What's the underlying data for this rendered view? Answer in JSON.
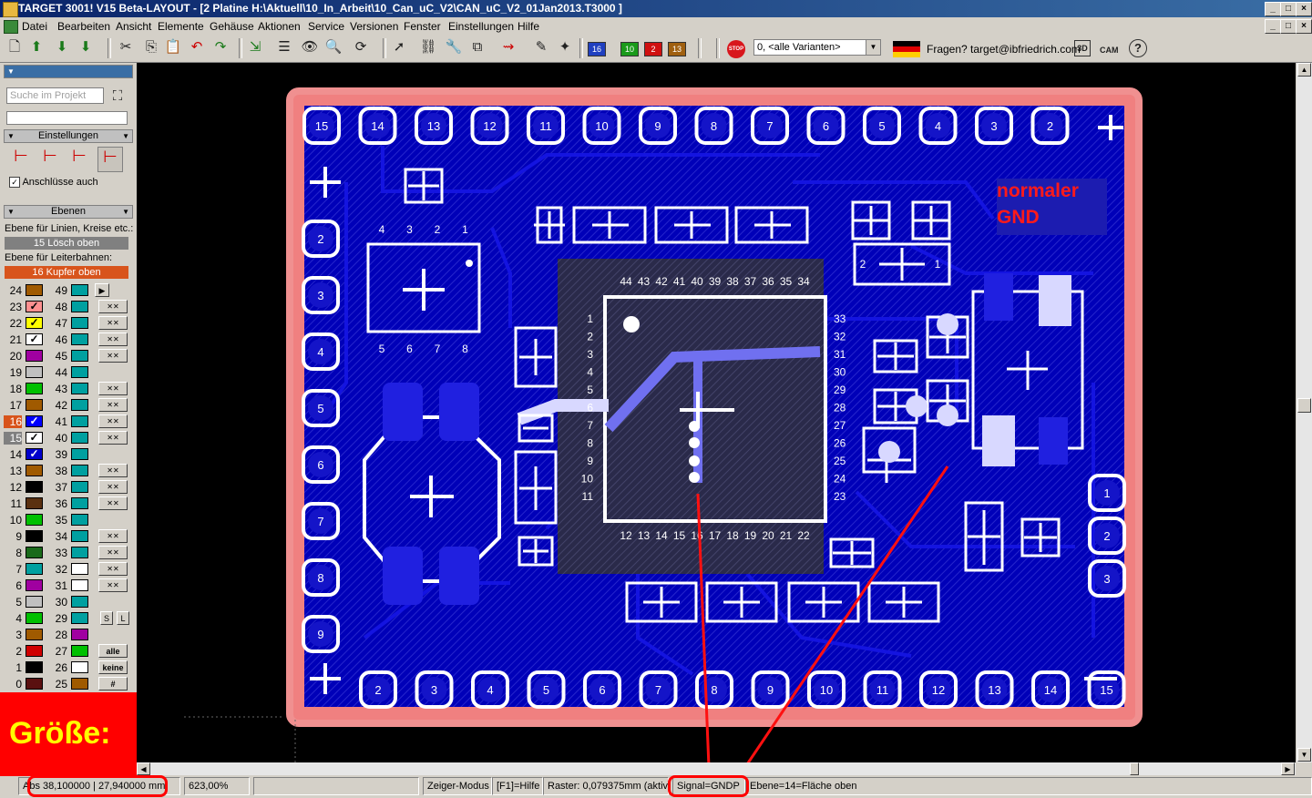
{
  "window": {
    "title": "TARGET 3001! V15 Beta-LAYOUT - [2 Platine H:\\Aktuell\\10_In_Arbeit\\10_Can_uC_V2\\CAN_uC_V2_01Jan2013.T3000 ]"
  },
  "menu": [
    "Datei",
    "Bearbeiten",
    "Ansicht",
    "Elemente",
    "Gehäuse",
    "Aktionen",
    "Service",
    "Versionen",
    "Fenster",
    "Einstellungen",
    "Hilfe"
  ],
  "toolbar": {
    "layer_badges": [
      "16",
      "10",
      "2",
      "13"
    ],
    "variant": "0, <alle Varianten>",
    "help": "Fragen? target@ibfriedrich.com",
    "stop_label": "STOP",
    "btn_3d": "3D",
    "btn_cam": "CAM",
    "btn_help": "?"
  },
  "left_panel": {
    "search_placeholder": "Suche im Projekt",
    "settings_header": "Einstellungen",
    "also_connections": "Anschlüsse auch",
    "layers_header": "Ebenen",
    "line_layer_label": "Ebene für Linien, Kreise etc.:",
    "line_layer_value": "15 Lösch oben",
    "track_layer_label": "Ebene für Leiterbahnen:",
    "track_layer_value": "16 Kupfer oben",
    "btn_s": "S",
    "btn_l": "L",
    "btn_all": "alle",
    "btn_none": "keine",
    "btn_hash": "#",
    "layers_left": [
      {
        "n": "24",
        "color": "#a05a00",
        "mark": ""
      },
      {
        "n": "23",
        "color": "#ff9090",
        "mark": "✓"
      },
      {
        "n": "22",
        "color": "#ffff00",
        "mark": "✓"
      },
      {
        "n": "21",
        "color": "#ffffff",
        "mark": "✓"
      },
      {
        "n": "20",
        "color": "#a000a0",
        "mark": ""
      },
      {
        "n": "19",
        "color": "#c0c0c0",
        "mark": ""
      },
      {
        "n": "18",
        "color": "#00c000",
        "mark": ""
      },
      {
        "n": "17",
        "color": "#a05a00",
        "mark": ""
      },
      {
        "n": "16",
        "color": "#0000ff",
        "mark": "✓"
      },
      {
        "n": "15",
        "color": "#ffffff",
        "mark": "✓"
      },
      {
        "n": "14",
        "color": "#0000cc",
        "mark": "✓"
      },
      {
        "n": "13",
        "color": "#a05a00",
        "mark": ""
      },
      {
        "n": "12",
        "color": "#000000",
        "mark": ""
      },
      {
        "n": "11",
        "color": "#5a3010",
        "mark": ""
      },
      {
        "n": "10",
        "color": "#00c000",
        "mark": ""
      },
      {
        "n": "9",
        "color": "#000000",
        "mark": ""
      },
      {
        "n": "8",
        "color": "#1a6a1a",
        "mark": ""
      },
      {
        "n": "7",
        "color": "#00a0a0",
        "mark": ""
      },
      {
        "n": "6",
        "color": "#a000a0",
        "mark": ""
      },
      {
        "n": "5",
        "color": "#c0c0c0",
        "mark": ""
      },
      {
        "n": "4",
        "color": "#00c000",
        "mark": ""
      },
      {
        "n": "3",
        "color": "#a05a00",
        "mark": ""
      },
      {
        "n": "2",
        "color": "#d00000",
        "mark": ""
      },
      {
        "n": "1",
        "color": "#000000",
        "mark": ""
      },
      {
        "n": "0",
        "color": "#5a1010",
        "mark": ""
      }
    ],
    "layers_right": [
      {
        "n": "49",
        "color": "#00a0a0"
      },
      {
        "n": "48",
        "color": "#00a0a0"
      },
      {
        "n": "47",
        "color": "#00a0a0"
      },
      {
        "n": "46",
        "color": "#00a0a0"
      },
      {
        "n": "45",
        "color": "#00a0a0"
      },
      {
        "n": "44",
        "color": "#00a0a0"
      },
      {
        "n": "43",
        "color": "#00a0a0"
      },
      {
        "n": "42",
        "color": "#00a0a0"
      },
      {
        "n": "41",
        "color": "#00a0a0"
      },
      {
        "n": "40",
        "color": "#00a0a0"
      },
      {
        "n": "39",
        "color": "#00a0a0"
      },
      {
        "n": "38",
        "color": "#00a0a0"
      },
      {
        "n": "37",
        "color": "#00a0a0"
      },
      {
        "n": "36",
        "color": "#00a0a0"
      },
      {
        "n": "35",
        "color": "#00a0a0"
      },
      {
        "n": "34",
        "color": "#00a0a0"
      },
      {
        "n": "33",
        "color": "#00a0a0"
      },
      {
        "n": "32",
        "color": "#ffffff"
      },
      {
        "n": "31",
        "color": "#ffffff"
      },
      {
        "n": "30",
        "color": "#00a0a0"
      },
      {
        "n": "29",
        "color": "#00a0a0"
      },
      {
        "n": "28",
        "color": "#a000a0"
      },
      {
        "n": "27",
        "color": "#00c000"
      },
      {
        "n": "26",
        "color": "#ffffff"
      },
      {
        "n": "25",
        "color": "#a05a00"
      }
    ]
  },
  "pcb": {
    "annotation": [
      "normaler",
      "GND"
    ],
    "top_pads": [
      "15",
      "14",
      "13",
      "12",
      "11",
      "10",
      "9",
      "8",
      "7",
      "6",
      "5",
      "4",
      "3",
      "2"
    ],
    "bottom_pads": [
      "2",
      "3",
      "4",
      "5",
      "6",
      "7",
      "8",
      "9",
      "10",
      "11",
      "12",
      "13",
      "14",
      "15"
    ],
    "left_pads": [
      "2",
      "3",
      "4",
      "5",
      "6",
      "7",
      "8",
      "9"
    ],
    "right_pads": [
      "1",
      "2",
      "3"
    ],
    "ic_top_pins": [
      "44",
      "43",
      "42",
      "41",
      "40",
      "39",
      "38",
      "37",
      "36",
      "35",
      "34"
    ],
    "ic_bottom_pins": [
      "12",
      "13",
      "14",
      "15",
      "16",
      "17",
      "18",
      "19",
      "20",
      "21",
      "22"
    ],
    "ic_left_pins": [
      "1",
      "2",
      "3",
      "4",
      "5",
      "6",
      "7",
      "8",
      "9",
      "10",
      "11"
    ],
    "ic_right_pins": [
      "33",
      "32",
      "31",
      "30",
      "29",
      "28",
      "27",
      "26",
      "25",
      "24",
      "23"
    ],
    "soic_top_pins": [
      "4",
      "3",
      "2",
      "1"
    ],
    "soic_bottom_pins": [
      "5",
      "6",
      "7",
      "8"
    ],
    "reg_pins": [
      "2",
      "1"
    ]
  },
  "highlight": {
    "groesse": "Größe:"
  },
  "status": {
    "coords": "Abs 38,100000 | 27,940000 mm",
    "zoom": "623,00%",
    "empty": "",
    "mode": "Zeiger-Modus",
    "f1": "[F1]=Hilfe",
    "grid": "Raster: 0,079375mm (aktiv)",
    "signal": "Signal=GNDP",
    "layer": "Ebene=14=Fläche oben"
  }
}
